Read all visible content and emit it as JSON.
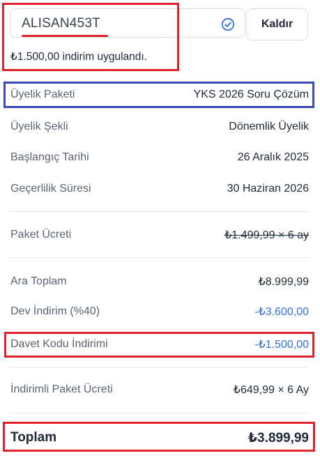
{
  "coupon": {
    "code": "ALISAN453T",
    "remove_label": "Kaldır",
    "success_message": "₺1.500,00 indirim uygulandı."
  },
  "details": {
    "package_label": "Üyelik Paketi",
    "package_value": "YKS 2026 Soru Çözüm",
    "type_label": "Üyelik Şekli",
    "type_value": "Dönemlik Üyelik",
    "start_label": "Başlangıç Tarihi",
    "start_value": "26 Aralık 2025",
    "valid_label": "Geçerlilik Süresi",
    "valid_value": "30 Haziran 2026"
  },
  "pricing": {
    "fee_label": "Paket Ücreti",
    "fee_value": "₺1.499,99 × 6 ay",
    "subtotal_label": "Ara Toplam",
    "subtotal_value": "₺8.999,99",
    "big_discount_label": "Dev İndirim (%40)",
    "big_discount_value": "-₺3.600,00",
    "invite_discount_label": "Davet Kodu İndirimi",
    "invite_discount_value": "-₺1.500,00",
    "discounted_fee_label": "İndirimli Paket Ücreti",
    "discounted_fee_value": "₺649,99 × 6 Ay",
    "total_label": "Toplam",
    "total_value": "₺3.899,99"
  },
  "colors": {
    "annotation_red": "#e0222c",
    "annotation_blue": "#3a47b8",
    "discount_blue": "#2f73d8"
  }
}
